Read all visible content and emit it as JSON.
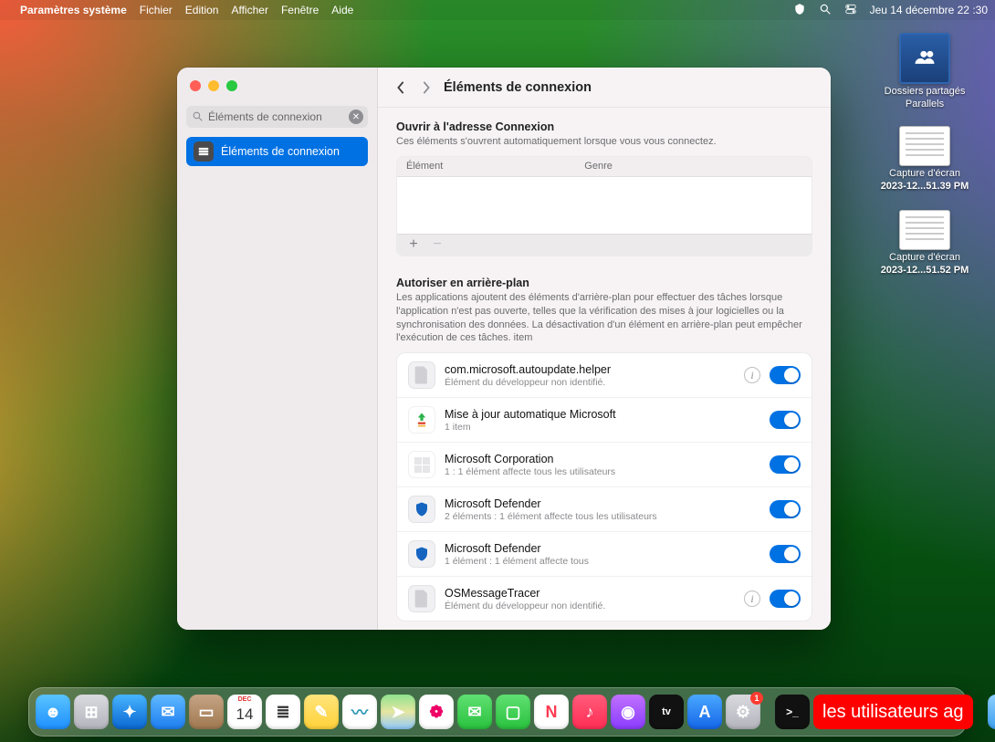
{
  "menubar": {
    "app": "Paramètres système",
    "items": [
      "Fichier",
      "Edition",
      "Afficher",
      "Fenêtre",
      "Aide"
    ],
    "clock": "Jeu 14 décembre 22 :30"
  },
  "desktop_icons": [
    {
      "kind": "folder",
      "line1": "Dossiers partagés",
      "line2": "Parallels"
    },
    {
      "kind": "shot",
      "line1": "Capture d'écran",
      "line2": "2023-12...51.39 PM"
    },
    {
      "kind": "shot",
      "line1": "Capture d'écran",
      "line2": "2023-12...51.52 PM"
    }
  ],
  "window": {
    "search_value": "Éléments de connexion",
    "sidebar_selected": "Éléments de connexion",
    "title": "Éléments de connexion",
    "open_section": {
      "title": "Ouvrir à l'adresse Connexion",
      "desc": "Ces éléments s'ouvrent automatiquement lorsque vous vous connectez.",
      "col_element": "Élément",
      "col_kind": "Genre"
    },
    "bg_section": {
      "title": "Autoriser en arrière-plan",
      "desc": "Les applications ajoutent des éléments d'arrière-plan pour effectuer des tâches lorsque l'application n'est pas ouverte, telles que la vérification des mises à jour logicielles ou la synchronisation des données. La désactivation d'un élément en arrière-plan peut empêcher l'exécution de ces tâches. item"
    },
    "bg_items": [
      {
        "icon": "doc",
        "name": "com.microsoft.autoupdate.helper",
        "sub": "Élément du développeur non identifié.",
        "info": true,
        "on": true
      },
      {
        "icon": "update",
        "name": "Mise à jour automatique Microsoft",
        "sub": "1 item",
        "info": false,
        "on": true
      },
      {
        "icon": "ms",
        "name": "Microsoft Corporation",
        "sub": "1 : 1 élément affecte tous les utilisateurs",
        "info": false,
        "on": true
      },
      {
        "icon": "shield",
        "name": "Microsoft Defender",
        "sub": "2 éléments : 1 élément affecte tous les utilisateurs",
        "info": false,
        "on": true
      },
      {
        "icon": "shield",
        "name": "Microsoft Defender",
        "sub": "1 élément : 1 élément affecte tous",
        "info": false,
        "on": true
      },
      {
        "icon": "doc",
        "name": "OSMessageTracer",
        "sub": "Élément du développeur non identifié.",
        "info": true,
        "on": true
      }
    ]
  },
  "dock": {
    "apps": [
      {
        "name": "finder",
        "bg": "linear-gradient(#59c3ff,#1e90ff)",
        "glyph": "☻"
      },
      {
        "name": "launchpad",
        "bg": "linear-gradient(#d9d9df,#b4b4bd)",
        "glyph": "⊞"
      },
      {
        "name": "safari",
        "bg": "linear-gradient(#47b4ff,#0a67d1)",
        "glyph": "✦"
      },
      {
        "name": "mail",
        "bg": "linear-gradient(#5fb9ff,#1d7ef0)",
        "glyph": "✉"
      },
      {
        "name": "contacts",
        "bg": "linear-gradient(#c6a484,#a07850)",
        "glyph": "▭"
      },
      {
        "name": "calendar",
        "bg": "#ffffff",
        "glyph": "14",
        "text": "#e03030",
        "top": "DEC"
      },
      {
        "name": "reminders",
        "bg": "#ffffff",
        "glyph": "≣",
        "text": "#333"
      },
      {
        "name": "notes",
        "bg": "linear-gradient(#ffe47a,#ffd23a)",
        "glyph": "✎"
      },
      {
        "name": "freeform",
        "bg": "#ffffff",
        "glyph": "〰",
        "text": "#39b"
      },
      {
        "name": "maps",
        "bg": "linear-gradient(#8fe28f,#e6e6a0 50%,#8fcaff)",
        "glyph": "➤"
      },
      {
        "name": "photos",
        "bg": "#ffffff",
        "glyph": "❁",
        "text": "#e06"
      },
      {
        "name": "messages",
        "bg": "linear-gradient(#60e072,#29c23e)",
        "glyph": "✉"
      },
      {
        "name": "facetime",
        "bg": "linear-gradient(#60e072,#29c23e)",
        "glyph": "▢"
      },
      {
        "name": "news",
        "bg": "#ffffff",
        "glyph": "N",
        "text": "#ff3b52"
      },
      {
        "name": "music",
        "bg": "linear-gradient(#ff5b7a,#ff2d55)",
        "glyph": "♪"
      },
      {
        "name": "podcasts",
        "bg": "linear-gradient(#c071ff,#8a3cff)",
        "glyph": "◉"
      },
      {
        "name": "tv",
        "bg": "#111",
        "glyph": "tv",
        "text": "#fff",
        "fs": "11px"
      },
      {
        "name": "appstore",
        "bg": "linear-gradient(#4aa8ff,#1466e8)",
        "glyph": "A"
      },
      {
        "name": "settings",
        "bg": "linear-gradient(#d9d9df,#b4b4bd)",
        "glyph": "⚙",
        "badge": "1"
      }
    ],
    "right": [
      {
        "name": "terminal",
        "bg": "#111",
        "glyph": ">_",
        "text": "#fff",
        "fs": "12px"
      }
    ],
    "label_text": "les utilisateurs ag",
    "tail": [
      {
        "name": "folder",
        "bg": "linear-gradient(#8fd0ff,#3ea0ef)",
        "glyph": "▥"
      },
      {
        "name": "trash",
        "bg": "linear-gradient(#e7e7ea,#bfbfc5)",
        "glyph": "🗑",
        "text": "#888"
      }
    ]
  }
}
